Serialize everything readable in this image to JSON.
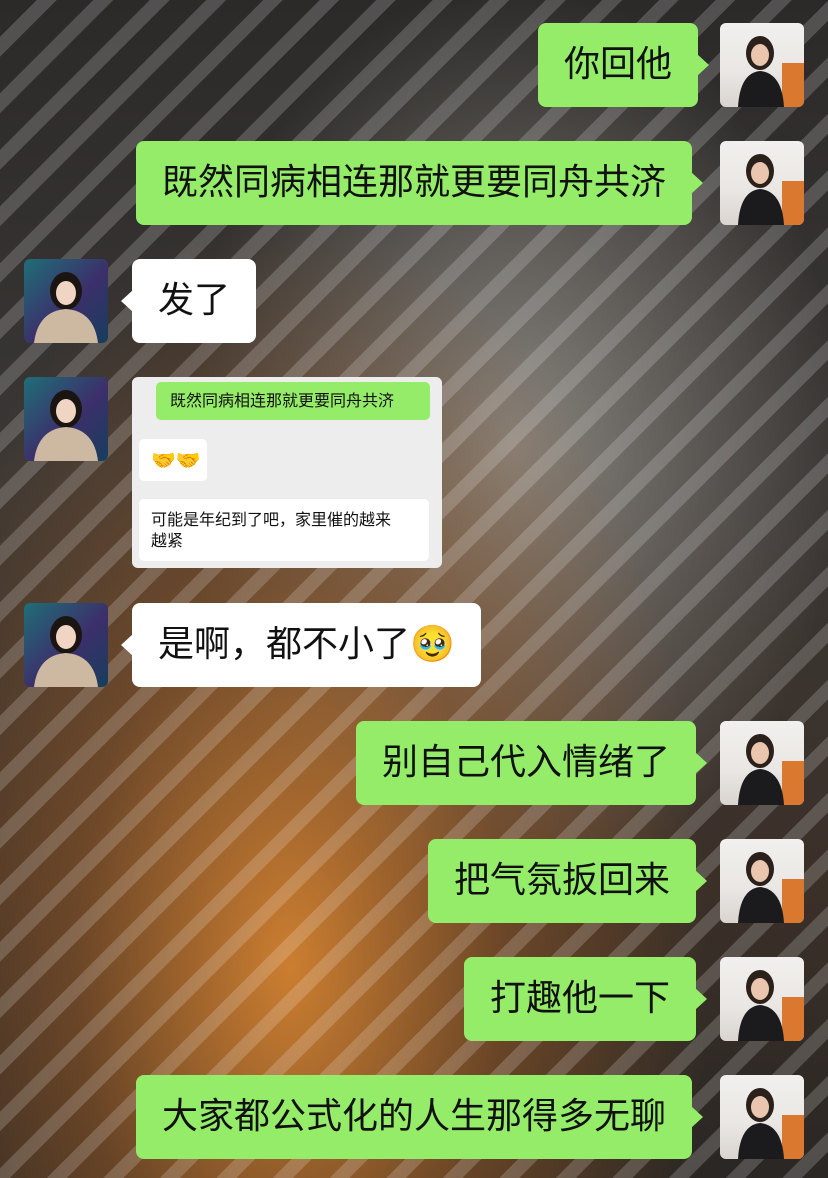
{
  "messages": [
    {
      "side": "sent",
      "text": "你回他"
    },
    {
      "side": "sent",
      "text": "既然同病相连那就更要同舟共济"
    },
    {
      "side": "received",
      "text": "发了"
    },
    {
      "side": "received",
      "type": "screenshot",
      "screenshot": {
        "sent_text": "既然同病相连那就更要同舟共济",
        "reply_emoji": "🤝🤝",
        "reply_text_line1": "可能是年纪到了吧，家里催的越来",
        "reply_text_line2": "越紧"
      }
    },
    {
      "side": "received",
      "text": "是啊，都不小了🥹"
    },
    {
      "side": "sent",
      "text": "别自己代入情绪了"
    },
    {
      "side": "sent",
      "text": "把气氛扳回来"
    },
    {
      "side": "sent",
      "text": "打趣他一下"
    },
    {
      "side": "sent",
      "text": "大家都公式化的人生那得多无聊"
    }
  ],
  "colors": {
    "sent_bubble": "#95ec69",
    "received_bubble": "#ffffff"
  }
}
